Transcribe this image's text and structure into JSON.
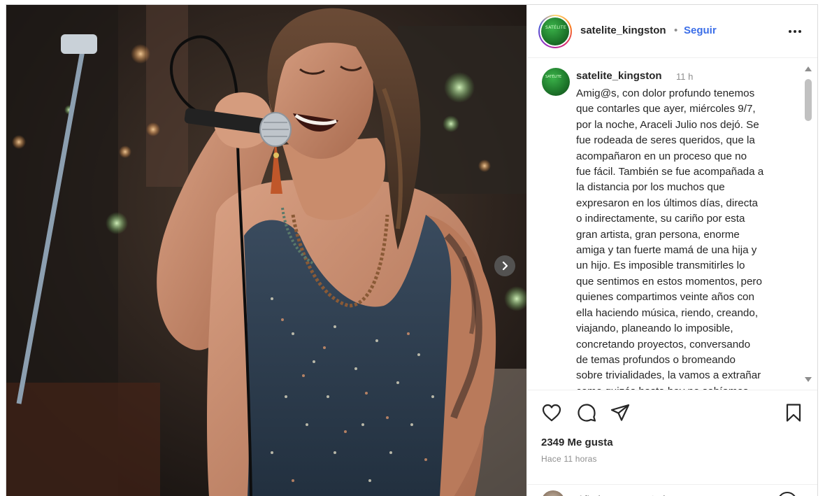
{
  "post": {
    "username": "satelite_kingston",
    "dot": "•",
    "follow_label": "Seguir",
    "avatar_text": "SATÉLITE",
    "time_ago": "11 h",
    "caption_lines": [
      "Amig@s, con dolor profundo tenemos",
      "que contarles que ayer, miércoles 9/7,",
      "por la noche, Araceli Julio nos dejó. Se",
      "fue rodeada de seres queridos, que la",
      "acompañaron en un proceso que no",
      "fue fácil. También se fue acompañada a",
      "la distancia por los muchos que",
      "expresaron en los últimos días, directa",
      "o indirectamente, su cariño por esta",
      "gran artista, gran persona, enorme",
      "amiga y tan fuerte mamá de una hija y",
      "un hijo. Es imposible transmitirles lo",
      "que sentimos en estos momentos, pero",
      "quienes compartimos veinte años con",
      "ella haciendo música, riendo, creando,",
      "viajando, planeando lo imposible,",
      "concretando proyectos, conversando",
      "de temas profundos o bromeando",
      "sobre trivialidades, la vamos a extrañar",
      "como quizás hasta hoy no sabíamos"
    ],
    "likes": "2349 Me gusta",
    "posted_time": "Hace 11 horas",
    "comment_placeholder": "Añade un comentario..."
  },
  "icons": {
    "like": "heart-icon",
    "comment": "comment-icon",
    "share": "share-icon",
    "save": "bookmark-icon",
    "next": "chevron-right-icon",
    "more": "more-icon",
    "emoji": "emoji-icon"
  },
  "colors": {
    "link": "#3b6ee8",
    "muted": "#8e8e8e",
    "text": "#262626"
  }
}
